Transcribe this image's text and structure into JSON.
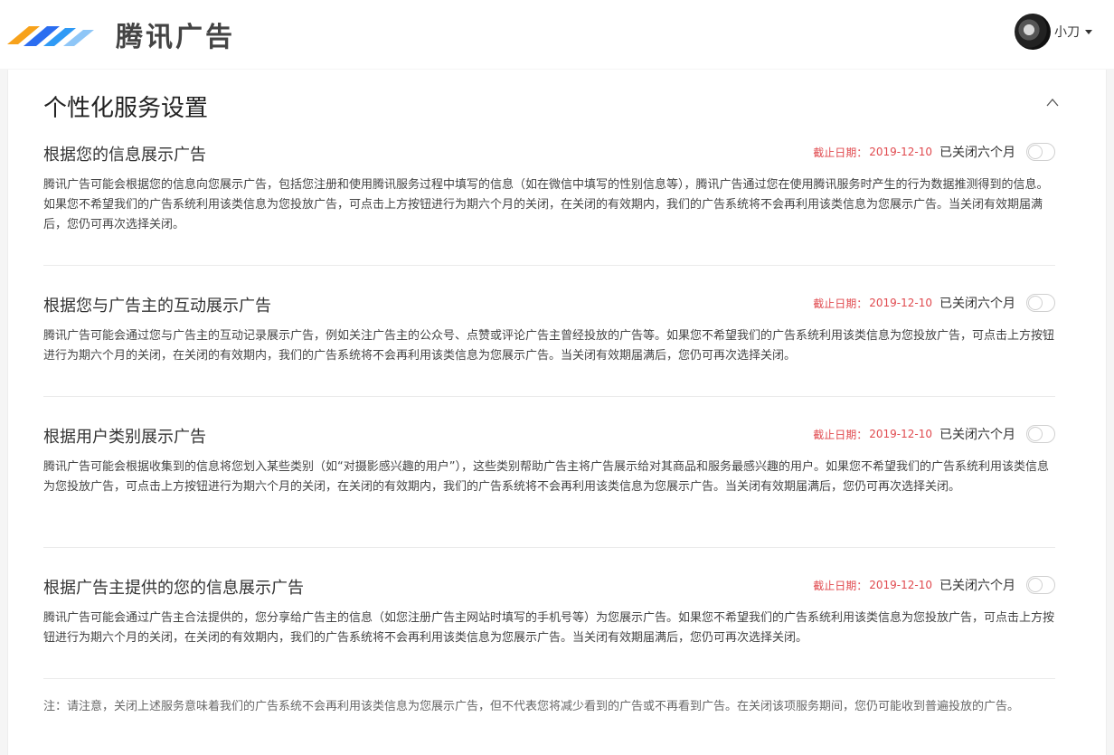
{
  "header": {
    "logo_text": "腾讯广告",
    "logo_icon": "tencent-ads-logo",
    "user": {
      "name": "小刀",
      "avatar_icon": "user-avatar"
    }
  },
  "panel": {
    "title": "个性化服务设置",
    "collapse_icon": "chevron-up-icon",
    "sections": [
      {
        "title": "根据您的信息展示广告",
        "deadline_label": "截止日期：",
        "deadline_date": "2019-12-10",
        "status": "已关闭六个月",
        "toggle_on": false,
        "description": "腾讯广告可能会根据您的信息向您展示广告，包括您注册和使用腾讯服务过程中填写的信息（如在微信中填写的性别信息等），腾讯广告通过您在使用腾讯服务时产生的行为数据推测得到的信息。如果您不希望我们的广告系统利用该类信息为您投放广告，可点击上方按钮进行为期六个月的关闭，在关闭的有效期内，我们的广告系统将不会再利用该类信息为您展示广告。当关闭有效期届满后，您仍可再次选择关闭。"
      },
      {
        "title": "根据您与广告主的互动展示广告",
        "deadline_label": "截止日期：",
        "deadline_date": "2019-12-10",
        "status": "已关闭六个月",
        "toggle_on": false,
        "description": "腾讯广告可能会通过您与广告主的互动记录展示广告，例如关注广告主的公众号、点赞或评论广告主曾经投放的广告等。如果您不希望我们的广告系统利用该类信息为您投放广告，可点击上方按钮进行为期六个月的关闭，在关闭的有效期内，我们的广告系统将不会再利用该类信息为您展示广告。当关闭有效期届满后，您仍可再次选择关闭。"
      },
      {
        "title": "根据用户类别展示广告",
        "deadline_label": "截止日期：",
        "deadline_date": "2019-12-10",
        "status": "已关闭六个月",
        "toggle_on": false,
        "description": "腾讯广告可能会根据收集到的信息将您划入某些类别（如“对摄影感兴趣的用户”），这些类别帮助广告主将广告展示给对其商品和服务最感兴趣的用户。如果您不希望我们的广告系统利用该类信息为您投放广告，可点击上方按钮进行为期六个月的关闭，在关闭的有效期内，我们的广告系统将不会再利用该类信息为您展示广告。当关闭有效期届满后，您仍可再次选择关闭。"
      },
      {
        "title": "根据广告主提供的您的信息展示广告",
        "deadline_label": "截止日期：",
        "deadline_date": "2019-12-10",
        "status": "已关闭六个月",
        "toggle_on": false,
        "description": "腾讯广告可能会通过广告主合法提供的，您分享给广告主的信息（如您注册广告主网站时填写的手机号等）为您展示广告。如果您不希望我们的广告系统利用该类信息为您投放广告，可点击上方按钮进行为期六个月的关闭，在关闭的有效期内，我们的广告系统将不会再利用该类信息为您展示广告。当关闭有效期届满后，您仍可再次选择关闭。"
      }
    ],
    "note": "注：请注意，关闭上述服务意味着我们的广告系统不会再利用该类信息为您展示广告，但不代表您将减少看到的广告或不再看到广告。在关闭该项服务期间，您仍可能收到普遍投放的广告。"
  }
}
